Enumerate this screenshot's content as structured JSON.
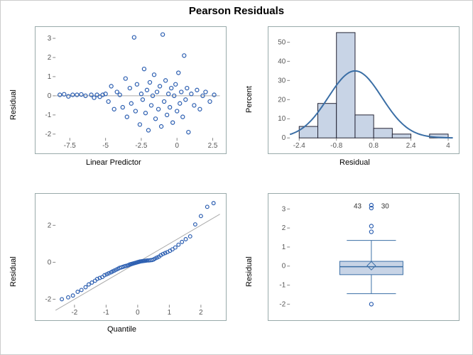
{
  "title": "Pearson Residuals",
  "panels": {
    "scatter": {
      "xlabel": "Linear Predictor",
      "ylabel": "Residual"
    },
    "hist": {
      "xlabel": "Residual",
      "ylabel": "Percent"
    },
    "qq": {
      "xlabel": "Quantile",
      "ylabel": "Residual"
    },
    "box": {
      "xlabel": "",
      "ylabel": "Residual",
      "outlier_labels": [
        "43",
        "30"
      ]
    }
  },
  "chart_data": [
    {
      "type": "scatter",
      "title": "",
      "xlabel": "Linear Predictor",
      "ylabel": "Residual",
      "xlim": [
        -8.5,
        3.0
      ],
      "ylim": [
        -2.2,
        3.3
      ],
      "xticks": [
        -7.5,
        -5.0,
        -2.5,
        0.0,
        2.5
      ],
      "yticks": [
        -2,
        -1,
        0,
        1,
        2,
        3
      ],
      "points": [
        [
          -8.2,
          0.05
        ],
        [
          -7.9,
          0.08
        ],
        [
          -7.6,
          -0.03
        ],
        [
          -7.3,
          0.05
        ],
        [
          -7.0,
          0.05
        ],
        [
          -6.7,
          0.07
        ],
        [
          -6.4,
          0.0
        ],
        [
          -6.0,
          0.05
        ],
        [
          -5.8,
          -0.1
        ],
        [
          -5.6,
          0.05
        ],
        [
          -5.4,
          -0.05
        ],
        [
          -5.2,
          0.05
        ],
        [
          -5.0,
          0.1
        ],
        [
          -4.8,
          -0.3
        ],
        [
          -4.6,
          0.5
        ],
        [
          -4.4,
          -0.7
        ],
        [
          -4.2,
          0.2
        ],
        [
          -4.0,
          0.05
        ],
        [
          -3.8,
          -0.6
        ],
        [
          -3.6,
          0.9
        ],
        [
          -3.5,
          -1.1
        ],
        [
          -3.3,
          0.4
        ],
        [
          -3.2,
          -0.4
        ],
        [
          -3.0,
          3.05
        ],
        [
          -2.9,
          -0.8
        ],
        [
          -2.8,
          0.6
        ],
        [
          -2.6,
          -1.5
        ],
        [
          -2.5,
          0.1
        ],
        [
          -2.4,
          -0.2
        ],
        [
          -2.3,
          1.4
        ],
        [
          -2.2,
          -0.9
        ],
        [
          -2.1,
          0.3
        ],
        [
          -2.0,
          -1.8
        ],
        [
          -1.9,
          0.7
        ],
        [
          -1.8,
          -0.5
        ],
        [
          -1.7,
          0.0
        ],
        [
          -1.6,
          1.1
        ],
        [
          -1.5,
          -1.2
        ],
        [
          -1.4,
          0.2
        ],
        [
          -1.3,
          -0.7
        ],
        [
          -1.2,
          0.5
        ],
        [
          -1.1,
          -1.6
        ],
        [
          -1.0,
          3.2
        ],
        [
          -0.9,
          -0.3
        ],
        [
          -0.8,
          0.8
        ],
        [
          -0.7,
          -1.0
        ],
        [
          -0.6,
          0.1
        ],
        [
          -0.5,
          -0.6
        ],
        [
          -0.4,
          0.4
        ],
        [
          -0.3,
          -1.4
        ],
        [
          -0.2,
          0.0
        ],
        [
          -0.1,
          0.6
        ],
        [
          0.0,
          -0.8
        ],
        [
          0.1,
          1.2
        ],
        [
          0.2,
          -0.4
        ],
        [
          0.3,
          0.2
        ],
        [
          0.4,
          -1.1
        ],
        [
          0.5,
          2.1
        ],
        [
          0.6,
          -0.2
        ],
        [
          0.7,
          0.4
        ],
        [
          0.8,
          -1.9
        ],
        [
          1.0,
          0.1
        ],
        [
          1.2,
          -0.5
        ],
        [
          1.4,
          0.3
        ],
        [
          1.6,
          -0.7
        ],
        [
          1.8,
          0.0
        ],
        [
          2.0,
          0.2
        ],
        [
          2.3,
          -0.3
        ],
        [
          2.6,
          0.05
        ]
      ]
    },
    {
      "type": "bar",
      "title": "",
      "xlabel": "Residual",
      "ylabel": "Percent",
      "xlim": [
        -2.8,
        4.2
      ],
      "ylim": [
        0,
        55
      ],
      "xticks": [
        -2.4,
        -0.8,
        0.8,
        2.4,
        4.0
      ],
      "yticks": [
        0,
        10,
        20,
        30,
        40,
        50
      ],
      "categories": [
        -2.0,
        -1.2,
        -0.4,
        0.4,
        1.2,
        2.0,
        2.8,
        3.6
      ],
      "binwidth": 0.8,
      "values": [
        6,
        18,
        55,
        12,
        5,
        2,
        0,
        2
      ],
      "normal_curve": {
        "mu": 0.0,
        "sigma": 1.15,
        "peak": 35
      }
    },
    {
      "type": "scatter",
      "subtype": "qq",
      "title": "",
      "xlabel": "Quantile",
      "ylabel": "Residual",
      "xlim": [
        -2.6,
        2.6
      ],
      "ylim": [
        -2.3,
        3.4
      ],
      "xticks": [
        -2,
        -1,
        0,
        1,
        2
      ],
      "yticks": [
        -2,
        0,
        2
      ],
      "ref_line": {
        "slope": 1.0,
        "intercept": 0.0
      },
      "points": [
        [
          -2.4,
          -2.0
        ],
        [
          -2.2,
          -1.9
        ],
        [
          -2.05,
          -1.8
        ],
        [
          -1.9,
          -1.6
        ],
        [
          -1.78,
          -1.5
        ],
        [
          -1.65,
          -1.35
        ],
        [
          -1.55,
          -1.2
        ],
        [
          -1.45,
          -1.1
        ],
        [
          -1.35,
          -1.0
        ],
        [
          -1.28,
          -0.9
        ],
        [
          -1.2,
          -0.85
        ],
        [
          -1.12,
          -0.8
        ],
        [
          -1.05,
          -0.7
        ],
        [
          -0.98,
          -0.65
        ],
        [
          -0.92,
          -0.6
        ],
        [
          -0.85,
          -0.55
        ],
        [
          -0.8,
          -0.5
        ],
        [
          -0.74,
          -0.45
        ],
        [
          -0.68,
          -0.4
        ],
        [
          -0.62,
          -0.35
        ],
        [
          -0.57,
          -0.3
        ],
        [
          -0.52,
          -0.28
        ],
        [
          -0.47,
          -0.25
        ],
        [
          -0.42,
          -0.22
        ],
        [
          -0.38,
          -0.2
        ],
        [
          -0.33,
          -0.18
        ],
        [
          -0.29,
          -0.15
        ],
        [
          -0.25,
          -0.12
        ],
        [
          -0.21,
          -0.1
        ],
        [
          -0.17,
          -0.08
        ],
        [
          -0.13,
          -0.06
        ],
        [
          -0.09,
          -0.04
        ],
        [
          -0.05,
          -0.02
        ],
        [
          -0.01,
          0.0
        ],
        [
          0.03,
          0.02
        ],
        [
          0.07,
          0.04
        ],
        [
          0.11,
          0.05
        ],
        [
          0.15,
          0.06
        ],
        [
          0.19,
          0.07
        ],
        [
          0.23,
          0.08
        ],
        [
          0.27,
          0.09
        ],
        [
          0.31,
          0.1
        ],
        [
          0.35,
          0.1
        ],
        [
          0.4,
          0.11
        ],
        [
          0.45,
          0.12
        ],
        [
          0.5,
          0.15
        ],
        [
          0.55,
          0.2
        ],
        [
          0.61,
          0.25
        ],
        [
          0.67,
          0.3
        ],
        [
          0.73,
          0.38
        ],
        [
          0.8,
          0.45
        ],
        [
          0.87,
          0.5
        ],
        [
          0.94,
          0.55
        ],
        [
          1.02,
          0.62
        ],
        [
          1.1,
          0.7
        ],
        [
          1.19,
          0.8
        ],
        [
          1.29,
          0.95
        ],
        [
          1.4,
          1.1
        ],
        [
          1.52,
          1.25
        ],
        [
          1.66,
          1.4
        ],
        [
          1.82,
          2.05
        ],
        [
          2.0,
          2.5
        ],
        [
          2.2,
          3.0
        ],
        [
          2.4,
          3.2
        ]
      ]
    },
    {
      "type": "box",
      "title": "",
      "xlabel": "",
      "ylabel": "Residual",
      "ylim": [
        -2.4,
        3.5
      ],
      "yticks": [
        -2,
        -1,
        0,
        1,
        2,
        3
      ],
      "box": {
        "q1": -0.45,
        "median": -0.03,
        "q3": 0.25,
        "mean": 0.02,
        "whisker_low": -1.45,
        "whisker_high": 1.35
      },
      "outliers": [
        {
          "y": 3.2,
          "label": "43"
        },
        {
          "y": 3.05,
          "label": "30"
        },
        {
          "y": 2.1,
          "label": ""
        },
        {
          "y": 1.8,
          "label": ""
        },
        {
          "y": -2.0,
          "label": ""
        }
      ]
    }
  ]
}
